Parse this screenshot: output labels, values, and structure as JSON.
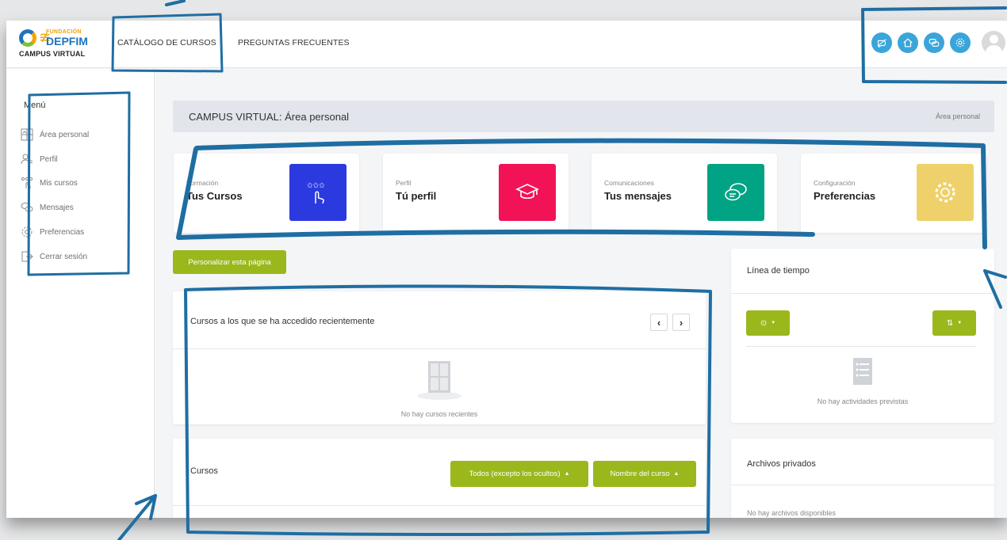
{
  "header": {
    "logo": {
      "small": "FUNDACIÓN",
      "big": "DEPFIM",
      "sub": "CAMPUS VIRTUAL"
    },
    "nav": [
      {
        "label": "CATÁLOGO DE CURSOS"
      },
      {
        "label": "PREGUNTAS FRECUENTES"
      }
    ],
    "icons": [
      "messages-off-icon",
      "home-icon",
      "chat-icon",
      "gear-icon"
    ],
    "icon_color": "#3aa5d9"
  },
  "sidebar": {
    "title": "Menú",
    "items": [
      {
        "label": "Área personal",
        "icon": "dashboard-icon"
      },
      {
        "label": "Perfil",
        "icon": "profile-icon"
      },
      {
        "label": "Mis cursos",
        "icon": "courses-icon"
      },
      {
        "label": "Mensajes",
        "icon": "messages-icon"
      },
      {
        "label": "Preferencias",
        "icon": "gear-icon"
      },
      {
        "label": "Cerrar sesión",
        "icon": "logout-icon"
      }
    ]
  },
  "page": {
    "title": "CAMPUS VIRTUAL: Área personal",
    "breadcrumb": "Área personal"
  },
  "cards": [
    {
      "caption": "Formación",
      "title": "Tus Cursos",
      "icon": "touch-stars-icon",
      "color": "#2b3adf"
    },
    {
      "caption": "Perfil",
      "title": "Tú perfil",
      "icon": "graduation-cap-icon",
      "color": "#f21356"
    },
    {
      "caption": "Comunicaciones",
      "title": "Tus mensajes",
      "icon": "chat-bubbles-icon",
      "color": "#00a383"
    },
    {
      "caption": "Configuración",
      "title": "Preferencias",
      "icon": "gear-icon",
      "color": "#eed16a"
    }
  ],
  "customize_button": "Personalizar esta página",
  "recent": {
    "title": "Cursos a los que se ha accedido recientemente",
    "empty": "No hay cursos recientes"
  },
  "courses": {
    "title": "Cursos",
    "filter_label": "Todos (excepto los ocultos)",
    "sort_label": "Nombre del curso"
  },
  "timeline": {
    "title": "Línea de tiempo",
    "empty": "No hay actividades previstas"
  },
  "private_files": {
    "title": "Archivos privados",
    "empty": "No hay archivos disponibles"
  },
  "colors": {
    "accent_green": "#9ab81c",
    "annotation_blue": "#1f6ea3"
  }
}
